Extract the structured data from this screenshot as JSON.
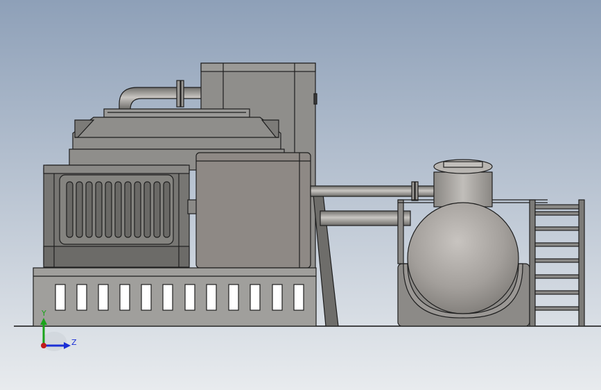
{
  "viewport": {
    "background_top": "#8ea0b8",
    "background_bottom": "#e8ebee"
  },
  "triad": {
    "y_label": "Y",
    "z_label": "Z",
    "y_color": "#1aa31a",
    "z_color": "#1b2fd6",
    "x_color": "#c01b1b"
  },
  "model": {
    "body_color": "#8f8e8b",
    "edge_color": "#1e1e1e"
  }
}
